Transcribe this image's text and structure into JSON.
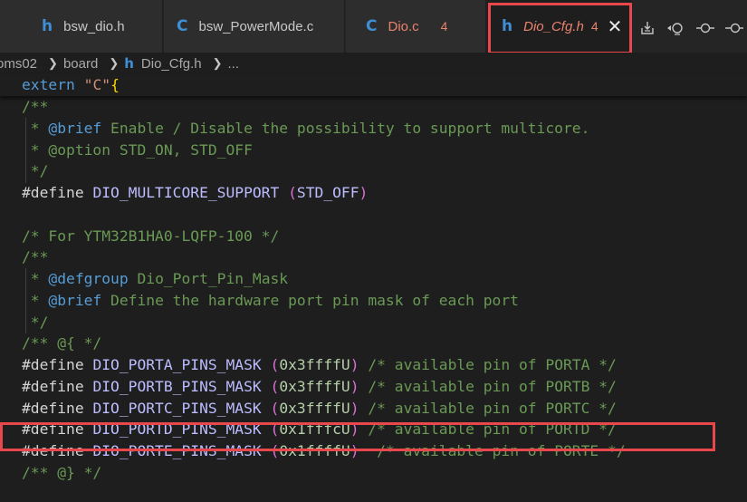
{
  "tabs": [
    {
      "icon": "h",
      "name": "bsw_dio.h",
      "badge": ""
    },
    {
      "icon": "C",
      "name": "bsw_PowerMode.c",
      "badge": ""
    },
    {
      "icon": "C",
      "name": "Dio.c",
      "badge": "4"
    },
    {
      "icon": "h",
      "name": "Dio_Cfg.h",
      "badge": "4",
      "close": "✕"
    }
  ],
  "toolbar": {
    "icons": [
      "compare-icon",
      "go-back-icon",
      "go-previous-change-icon",
      "go-next-change-icon"
    ]
  },
  "breadcrumb": {
    "folder1": "oms02",
    "folder2": "board",
    "file": "Dio_Cfg.h",
    "rest": "..."
  },
  "sticky": {
    "kw": "extern",
    "str": "\"C\"",
    "brace": "{"
  },
  "code": {
    "l1": "/**",
    "l2_star": " * ",
    "l2_tag": "@brief",
    "l2_text": " Enable / Disable the possibility to support multicore.",
    "l3_star": " * ",
    "l3_text": "@option STD_ON, STD_OFF",
    "l4": " */",
    "l5_pp": "#define",
    "l5_macro": "DIO_MULTICORE_SUPPORT",
    "l5_po": "(",
    "l5_val": "STD_OFF",
    "l5_pc": ")",
    "l7": "/* For YTM32B1HA0-LQFP-100 */",
    "l8": "/**",
    "l9_star": " * ",
    "l9_tag": "@defgroup",
    "l9_text": " Dio_Port_Pin_Mask",
    "l10_star": " * ",
    "l10_tag": "@brief",
    "l10_text": " Define the hardware port pin mask of each port",
    "l11": " */",
    "l12": "/** @{ */",
    "masks": [
      {
        "pp": "#define",
        "macro": "DIO_PORTA_PINS_MASK",
        "val": "0x3ffffU",
        "cm": "/* available pin of PORTA */",
        "pad": " "
      },
      {
        "pp": "#define",
        "macro": "DIO_PORTB_PINS_MASK",
        "val": "0x3ffffU",
        "cm": "/* available pin of PORTB */",
        "pad": " "
      },
      {
        "pp": "#define",
        "macro": "DIO_PORTC_PINS_MASK",
        "val": "0x3ffffU",
        "cm": "/* available pin of PORTC */",
        "pad": " "
      },
      {
        "pp": "#define",
        "macro": "DIO_PORTD_PINS_MASK",
        "val": "0x1fffcU",
        "cm": "/* available pin of PORTD */",
        "pad": " "
      },
      {
        "pp": "#define",
        "macro": "DIO_PORTE_PINS_MASK",
        "val": "0x1ffffU",
        "cm": "/* available pin of PORTE */",
        "pad": "  "
      }
    ],
    "l18": "/** @} */"
  },
  "colors": {
    "highlight": "#e8474b",
    "modified": "#e8826c"
  }
}
